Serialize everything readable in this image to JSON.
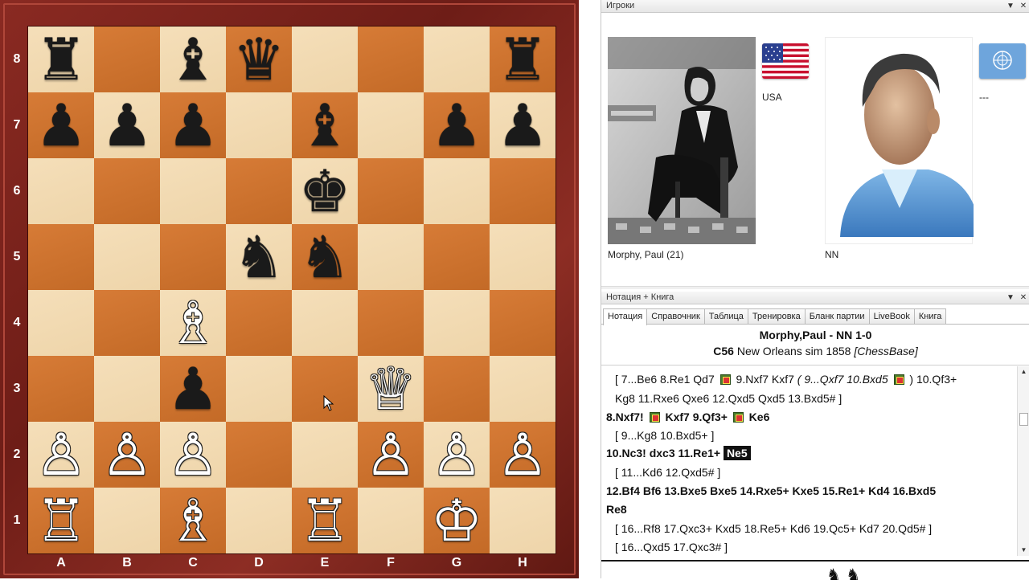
{
  "board": {
    "ranks": [
      "8",
      "7",
      "6",
      "5",
      "4",
      "3",
      "2",
      "1"
    ],
    "files": [
      "A",
      "B",
      "C",
      "D",
      "E",
      "F",
      "G",
      "H"
    ],
    "position": [
      [
        "bR",
        "",
        "bB",
        "bQ",
        "",
        "",
        "",
        "bR"
      ],
      [
        "bP",
        "bP",
        "bP",
        "",
        "bB",
        "",
        "bP",
        "bP"
      ],
      [
        "",
        "",
        "",
        "",
        "bK",
        "",
        "",
        ""
      ],
      [
        "",
        "",
        "",
        "bN",
        "bN",
        "",
        "",
        ""
      ],
      [
        "",
        "",
        "wB",
        "",
        "",
        "",
        "",
        ""
      ],
      [
        "",
        "",
        "bP",
        "",
        "",
        "wQ",
        "",
        ""
      ],
      [
        "wP",
        "wP",
        "wP",
        "",
        "",
        "wP",
        "wP",
        "wP"
      ],
      [
        "wR",
        "",
        "wB",
        "",
        "wR",
        "",
        "wK",
        ""
      ]
    ],
    "piece_glyphs": {
      "wK": "♔",
      "wQ": "♕",
      "wR": "♖",
      "wB": "♗",
      "wN": "♘",
      "wP": "♙",
      "bK": "♚",
      "bQ": "♛",
      "bR": "♜",
      "bB": "♝",
      "bN": "♞",
      "bP": "♟"
    },
    "colors": {
      "light": "#f3d9ad",
      "dark": "#d4732a",
      "frame": "#7a231b"
    }
  },
  "players_pane": {
    "title": "Игроки",
    "white": {
      "name": "Morphy, Paul  (21)",
      "country": "USA"
    },
    "black": {
      "name": "NN",
      "country": "---"
    }
  },
  "notation_pane": {
    "title": "Нотация + Книга",
    "tabs": [
      "Нотация",
      "Справочник",
      "Таблица",
      "Тренировка",
      "Бланк партии",
      "LiveBook",
      "Книга"
    ],
    "active_tab": "Нотация",
    "game_title": "Morphy,Paul - NN  1-0",
    "eco": "C56",
    "event": "New Orleans sim 1858",
    "source": "[ChessBase]",
    "lines": {
      "l1a": "[ 7...Be6  8.Re1  Qd7 ",
      "l1b": " 9.Nxf7  Kxf7 ",
      "l1c": "( 9...Qxf7  10.Bxd5 ",
      "l1d": " ) 10.Qf3+",
      "l2": "Kg8  11.Rxe6  Qxe6  12.Qxd5  Qxd5  13.Bxd5# ]",
      "l3a": "8.Nxf7! ",
      "l3b": " Kxf7  9.Qf3+ ",
      "l3c": " Ke6",
      "l4": "[ 9...Kg8  10.Bxd5+ ]",
      "l5a": "10.Nc3!  dxc3  11.Re1+ ",
      "l5b": "Ne5",
      "l6": "[ 11...Kd6  12.Qxd5# ]",
      "l7": "12.Bf4  Bf6  13.Bxe5  Bxe5  14.Rxe5+  Kxe5  15.Re1+  Kd4  16.Bxd5",
      "l8": "Re8",
      "l9": "[ 16...Rf8  17.Qxc3+  Kxd5  18.Re5+  Kd6  19.Qc5+  Kd7  20.Qd5# ]",
      "l10": "[ 16...Qxd5  17.Qxc3# ]"
    }
  },
  "bottom_icons": "♞ ♞"
}
